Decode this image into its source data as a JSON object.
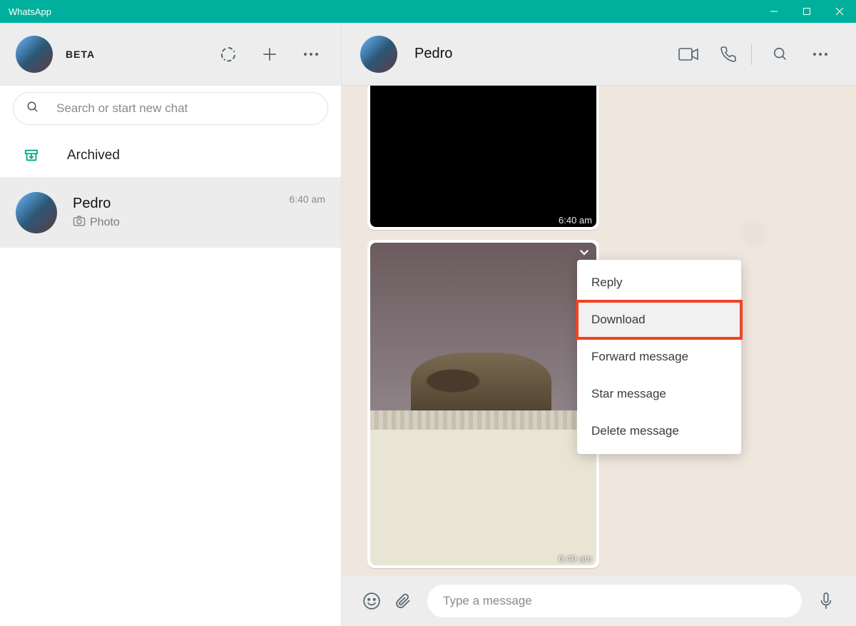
{
  "window": {
    "title": "WhatsApp"
  },
  "left": {
    "beta_label": "BETA",
    "search_placeholder": "Search or start new chat",
    "archived_label": "Archived",
    "chats": [
      {
        "name": "Pedro",
        "subtitle": "Photo",
        "time": "6:40 am"
      }
    ]
  },
  "conversation": {
    "contact_name": "Pedro",
    "messages": [
      {
        "id": "msg1",
        "type": "photo",
        "time": "6:40 am"
      },
      {
        "id": "msg2",
        "type": "photo",
        "time": "6:40 am"
      }
    ],
    "input_placeholder": "Type a message"
  },
  "context_menu": {
    "items": [
      {
        "label": "Reply"
      },
      {
        "label": "Download",
        "hover": true,
        "highlight": true
      },
      {
        "label": "Forward message"
      },
      {
        "label": "Star message"
      },
      {
        "label": "Delete message"
      }
    ]
  }
}
